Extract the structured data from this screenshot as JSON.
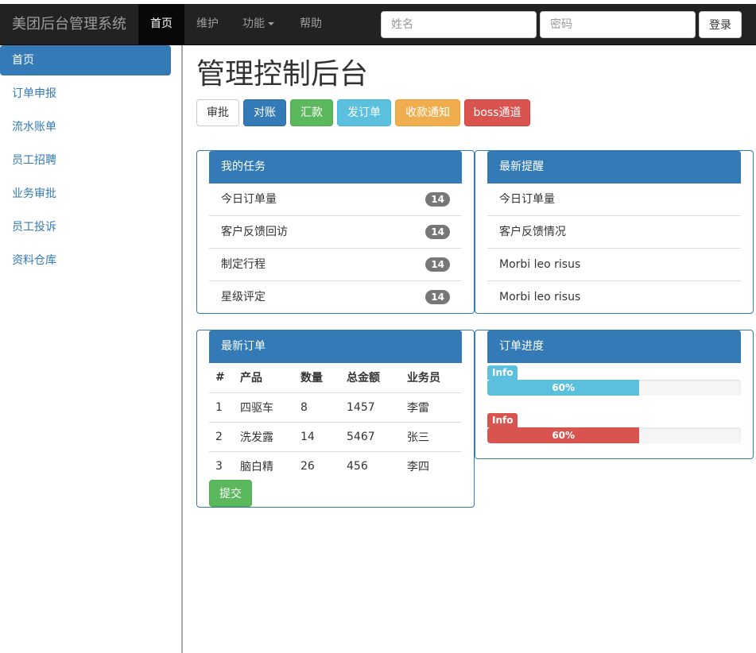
{
  "navbar": {
    "brand": "美团后台管理系统",
    "items": [
      {
        "label": "首页",
        "active": true
      },
      {
        "label": "维护"
      },
      {
        "label": "功能"
      },
      {
        "label": "帮助"
      }
    ],
    "username_placeholder": "姓名",
    "password_placeholder": "密码",
    "login_label": "登录"
  },
  "sidebar": {
    "items": [
      {
        "label": "首页",
        "active": true
      },
      {
        "label": "订单申报"
      },
      {
        "label": "流水账单"
      },
      {
        "label": "员工招聘"
      },
      {
        "label": "业务审批"
      },
      {
        "label": "员工投诉"
      },
      {
        "label": "资料仓库"
      }
    ]
  },
  "main": {
    "title": "管理控制后台",
    "buttons": [
      {
        "label": "审批",
        "color": "#ffffff"
      },
      {
        "label": "对账",
        "color": "#337ab7"
      },
      {
        "label": "汇款",
        "color": "#5cb85c"
      },
      {
        "label": "发订单",
        "color": "#5bc0de"
      },
      {
        "label": "收款通知",
        "color": "#f0ad4e"
      },
      {
        "label": "boss通道",
        "color": "#d9534f"
      }
    ]
  },
  "tasks": {
    "title": "我的任务",
    "items": [
      {
        "label": "今日订单量",
        "badge": "14"
      },
      {
        "label": "客户反馈回访",
        "badge": "14"
      },
      {
        "label": "制定行程",
        "badge": "14"
      },
      {
        "label": "星级评定",
        "badge": "14"
      }
    ]
  },
  "reminders": {
    "title": "最新提醒",
    "items": [
      "今日订单量",
      "客户反馈情况",
      "Morbi leo risus",
      "Morbi leo risus"
    ]
  },
  "orders": {
    "title": "最新订单",
    "columns": [
      "#",
      "产品",
      "数量",
      "总金额",
      "业务员"
    ],
    "rows": [
      [
        "1",
        "四驱车",
        "8",
        "1457",
        "李雷"
      ],
      [
        "2",
        "洗发露",
        "14",
        "5467",
        "张三"
      ],
      [
        "3",
        "脑白精",
        "26",
        "456",
        "李四"
      ]
    ],
    "submit_label": "提交"
  },
  "progress": {
    "title": "订单进度",
    "bars": [
      {
        "tag": "Info",
        "value_text": "60%",
        "value": 60,
        "color": "#5bc0de"
      },
      {
        "tag": "Info",
        "value_text": "60%",
        "value": 60,
        "color": "#d9534f"
      }
    ]
  }
}
